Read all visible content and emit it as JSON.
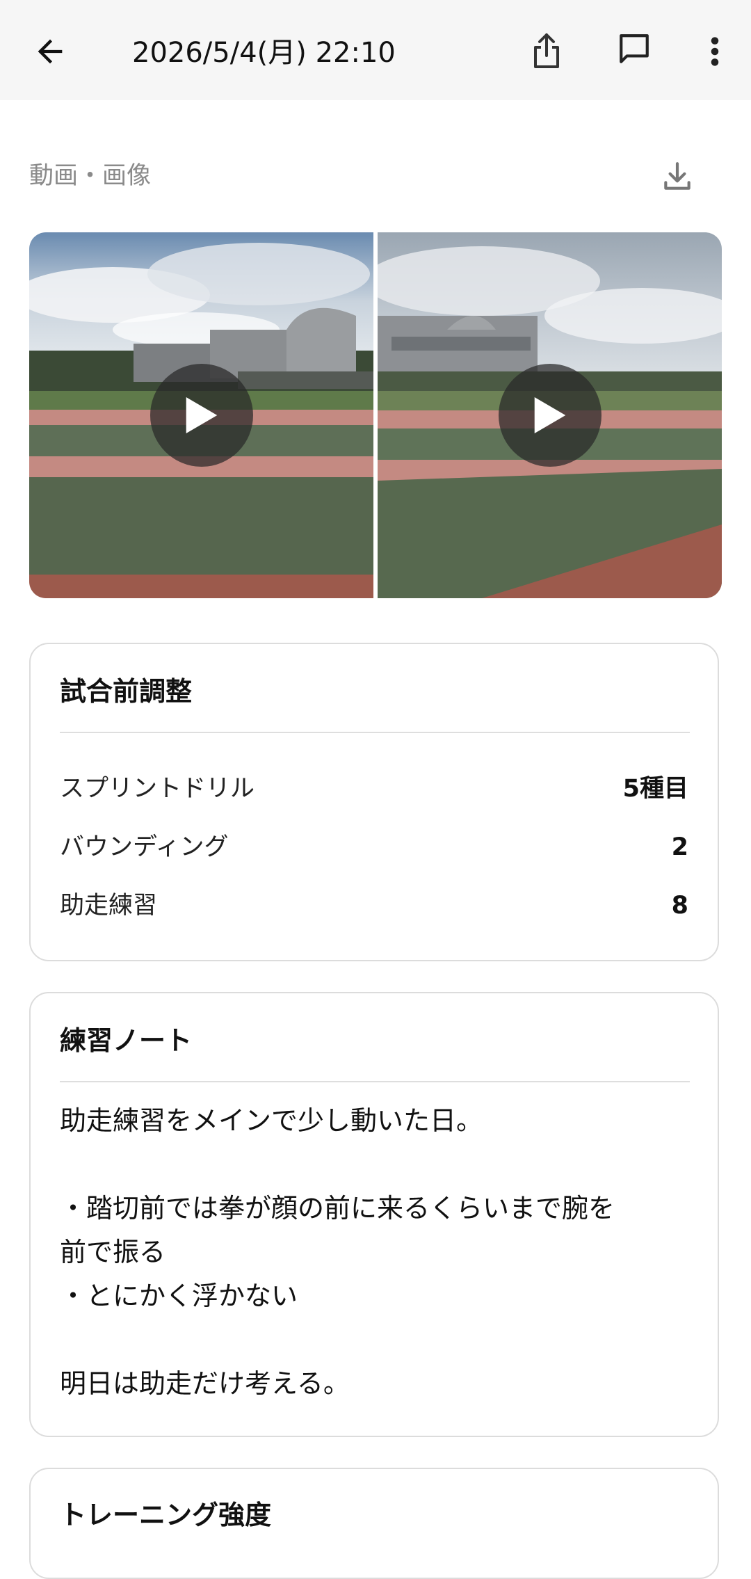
{
  "header": {
    "datetime": "2026/5/4(月) 22:10"
  },
  "media": {
    "label": "動画・画像"
  },
  "training_card": {
    "title": "試合前調整",
    "rows": [
      {
        "label": "スプリントドリル",
        "value": "5種目"
      },
      {
        "label": "バウンディング",
        "value": "2"
      },
      {
        "label": "助走練習",
        "value": "8"
      }
    ]
  },
  "note_card": {
    "title": "練習ノート",
    "lines": [
      "助走練習をメインで少し動いた日。",
      "",
      "・踏切前では拳が顔の前に来るくらいまで腕を",
      "前で振る",
      "・とにかく浮かない",
      "",
      "明日は助走だけ考える。"
    ]
  },
  "intensity_card": {
    "title": "トレーニング強度"
  }
}
